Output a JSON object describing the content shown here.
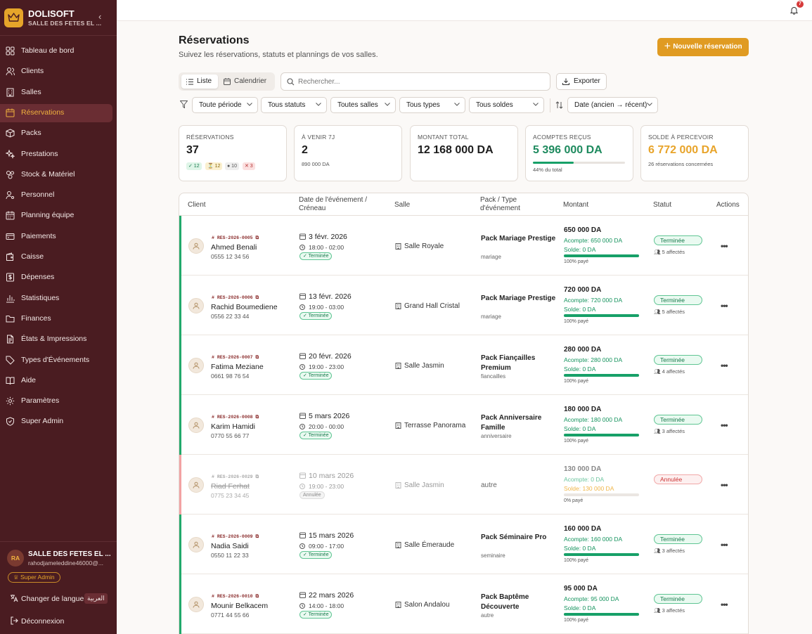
{
  "brand": {
    "name": "DOLISOFT",
    "subtitle": "SALLE DES FETES EL ...",
    "collapse": "‹"
  },
  "nav": [
    {
      "label": "Tableau de bord",
      "icon": "grid-icon",
      "active": false
    },
    {
      "label": "Clients",
      "icon": "users-icon",
      "active": false
    },
    {
      "label": "Salles",
      "icon": "building-icon",
      "active": false
    },
    {
      "label": "Réservations",
      "icon": "calendar-icon",
      "active": true
    },
    {
      "label": "Packs",
      "icon": "box-icon",
      "active": false
    },
    {
      "label": "Prestations",
      "icon": "sparkle-icon",
      "active": false
    },
    {
      "label": "Stock & Matériel",
      "icon": "package-icon",
      "active": false
    },
    {
      "label": "Personnel",
      "icon": "user-cog-icon",
      "active": false
    },
    {
      "label": "Planning équipe",
      "icon": "calendar-days-icon",
      "active": false
    },
    {
      "label": "Paiements",
      "icon": "credit-card-icon",
      "active": false
    },
    {
      "label": "Caisse",
      "icon": "wallet-icon",
      "active": false
    },
    {
      "label": "Dépenses",
      "icon": "receipt-icon",
      "active": false
    },
    {
      "label": "Statistiques",
      "icon": "bar-chart-icon",
      "active": false
    },
    {
      "label": "Finances",
      "icon": "folder-icon",
      "active": false
    },
    {
      "label": "États & Impressions",
      "icon": "file-text-icon",
      "active": false
    },
    {
      "label": "Types d'Événements",
      "icon": "tag-icon",
      "active": false
    },
    {
      "label": "Aide",
      "icon": "book-icon",
      "active": false
    },
    {
      "label": "Paramètres",
      "icon": "gear-icon",
      "active": false
    },
    {
      "label": "Super Admin",
      "icon": "shield-icon",
      "active": false
    }
  ],
  "user": {
    "initials": "RA",
    "name": "SALLE DES FETES EL ...",
    "email": "rahodjameleddine46000@...",
    "role": "♕ Super Admin"
  },
  "footer": {
    "lang_label": "Changer de langue",
    "lang_chip": "العربية",
    "logout": "Déconnexion"
  },
  "topbar": {
    "notif_count": "7"
  },
  "header": {
    "title": "Réservations",
    "subtitle": "Suivez les réservations, statuts et plannings de vos salles.",
    "new_button": "Nouvelle réservation"
  },
  "toolbar": {
    "view_list": "Liste",
    "view_calendar": "Calendrier",
    "search_placeholder": "Rechercher...",
    "export": "Exporter"
  },
  "filters": {
    "period": "Toute période",
    "status": "Tous statuts",
    "rooms": "Toutes salles",
    "types": "Tous types",
    "balances": "Tous soldes",
    "sort": "Date (ancien → récent)"
  },
  "stats": {
    "reservations": {
      "label": "Réservations",
      "value": "37",
      "chips": [
        "✓ 12",
        "⏳ 12",
        "● 10",
        "✕ 3"
      ]
    },
    "upcoming": {
      "label": "À venir 7J",
      "value": "2",
      "note": "890 000 DA"
    },
    "total": {
      "label": "Montant total",
      "value": "12 168 000 DA"
    },
    "deposits": {
      "label": "Acomptes reçus",
      "value": "5 396 000 DA",
      "note": "44% du total",
      "progress": 44
    },
    "balance": {
      "label": "Solde à percevoir",
      "value": "6 772 000 DA",
      "note": "26 réservations concernées"
    }
  },
  "table": {
    "headers": {
      "client": "Client",
      "date": "Date de l'événement / Créneau",
      "salle": "Salle",
      "pack": "Pack / Type d'événement",
      "montant": "Montant",
      "statut": "Statut",
      "actions": "Actions"
    },
    "rows": [
      {
        "ref": "RES-2026-0005",
        "name": "Ahmed Benali",
        "phone": "0555 12 34 56",
        "date": "3 févr. 2026",
        "time": "18:00 - 02:00",
        "row_status": "✓ Terminée",
        "salle": "Salle Royale",
        "pack": "Pack Mariage Prestige",
        "type": "mariage",
        "amount": "650 000 DA",
        "acompte": "Acompte: 650 000 DA",
        "solde": "Solde: 0 DA",
        "paid_pct": 100,
        "paid": "100% payé",
        "status": "Terminée",
        "assigned": "5 affectés",
        "cancel": false
      },
      {
        "ref": "RES-2026-0006",
        "name": "Rachid Boumediene",
        "phone": "0556 22 33 44",
        "date": "13 févr. 2026",
        "time": "19:00 - 03:00",
        "row_status": "✓ Terminée",
        "salle": "Grand Hall Cristal",
        "pack": "Pack Mariage Prestige",
        "type": "mariage",
        "amount": "720 000 DA",
        "acompte": "Acompte: 720 000 DA",
        "solde": "Solde: 0 DA",
        "paid_pct": 100,
        "paid": "100% payé",
        "status": "Terminée",
        "assigned": "5 affectés",
        "cancel": false
      },
      {
        "ref": "RES-2026-0007",
        "name": "Fatima Meziane",
        "phone": "0661 98 76 54",
        "date": "20 févr. 2026",
        "time": "19:00 - 23:00",
        "row_status": "✓ Terminée",
        "salle": "Salle Jasmin",
        "pack": "Pack Fiançailles Premium",
        "type": "fiancailles",
        "amount": "280 000 DA",
        "acompte": "Acompte: 280 000 DA",
        "solde": "Solde: 0 DA",
        "paid_pct": 100,
        "paid": "100% payé",
        "status": "Terminée",
        "assigned": "4 affectés",
        "cancel": false
      },
      {
        "ref": "RES-2026-0008",
        "name": "Karim Hamidi",
        "phone": "0770 55 66 77",
        "date": "5 mars 2026",
        "time": "20:00 - 00:00",
        "row_status": "✓ Terminée",
        "salle": "Terrasse Panorama",
        "pack": "Pack Anniversaire Famille",
        "type": "anniversaire",
        "amount": "180 000 DA",
        "acompte": "Acompte: 180 000 DA",
        "solde": "Solde: 0 DA",
        "paid_pct": 100,
        "paid": "100% payé",
        "status": "Terminée",
        "assigned": "3 affectés",
        "cancel": false
      },
      {
        "ref": "RES-2026-0029",
        "name": "Riad Ferhat",
        "phone": "0775 23 34 45",
        "date": "10 mars 2026",
        "time": "19:00 - 23:00",
        "row_status": "Annulée",
        "salle": "Salle Jasmin",
        "pack": "",
        "type": "autre",
        "amount": "130 000 DA",
        "acompte": "Acompte: 0 DA",
        "solde": "Solde: 130 000 DA",
        "paid_pct": 0,
        "paid": "0% payé",
        "status": "Annulée",
        "assigned": "",
        "cancel": true
      },
      {
        "ref": "RES-2026-0009",
        "name": "Nadia Saidi",
        "phone": "0550 11 22 33",
        "date": "15 mars 2026",
        "time": "09:00 - 17:00",
        "row_status": "✓ Terminée",
        "salle": "Salle Émeraude",
        "pack": "Pack Séminaire Pro",
        "type": "seminaire",
        "amount": "160 000 DA",
        "acompte": "Acompte: 160 000 DA",
        "solde": "Solde: 0 DA",
        "paid_pct": 100,
        "paid": "100% payé",
        "status": "Terminée",
        "assigned": "3 affectés",
        "cancel": false
      },
      {
        "ref": "RES-2026-0010",
        "name": "Mounir Belkacem",
        "phone": "0771 44 55 66",
        "date": "22 mars 2026",
        "time": "14:00 - 18:00",
        "row_status": "✓ Terminée",
        "salle": "Salon Andalou",
        "pack": "Pack Baptême Découverte",
        "type": "autre",
        "amount": "95 000 DA",
        "acompte": "Acompte: 95 000 DA",
        "solde": "Solde: 0 DA",
        "paid_pct": 100,
        "paid": "100% payé",
        "status": "Terminée",
        "assigned": "3 affectés",
        "cancel": false
      }
    ]
  }
}
